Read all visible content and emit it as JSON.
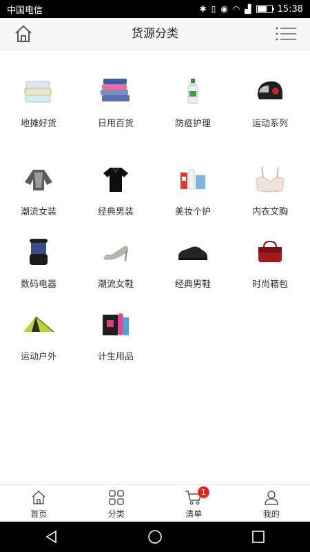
{
  "status_bar": {
    "carrier": "中国电信",
    "time": "15:38"
  },
  "header": {
    "title": "货源分类"
  },
  "categories": [
    {
      "label": "地摊好货",
      "icon": "storage-baskets-icon"
    },
    {
      "label": "日用百货",
      "icon": "towels-icon"
    },
    {
      "label": "防疫护理",
      "icon": "spray-bottle-icon"
    },
    {
      "label": "运动系列",
      "icon": "helmet-icon"
    },
    {
      "label": "潮流女装",
      "icon": "womens-jacket-icon"
    },
    {
      "label": "经典男装",
      "icon": "mens-polo-icon"
    },
    {
      "label": "美妆个护",
      "icon": "cosmetics-icon"
    },
    {
      "label": "内衣文胸",
      "icon": "bra-icon"
    },
    {
      "label": "数码电器",
      "icon": "mosquito-lamp-icon"
    },
    {
      "label": "潮流女鞋",
      "icon": "high-heel-icon"
    },
    {
      "label": "经典男鞋",
      "icon": "mens-shoe-icon"
    },
    {
      "label": "时尚箱包",
      "icon": "handbag-icon"
    },
    {
      "label": "运动户外",
      "icon": "tent-icon"
    },
    {
      "label": "计生用品",
      "icon": "adult-products-icon"
    }
  ],
  "bottom_nav": [
    {
      "label": "首页",
      "icon": "home-icon"
    },
    {
      "label": "分类",
      "icon": "category-grid-icon"
    },
    {
      "label": "清单",
      "icon": "cart-icon",
      "badge": "1"
    },
    {
      "label": "我的",
      "icon": "user-icon"
    }
  ],
  "colors": {
    "badge": "#e4261a",
    "header_bg": "#f7f7f7"
  }
}
